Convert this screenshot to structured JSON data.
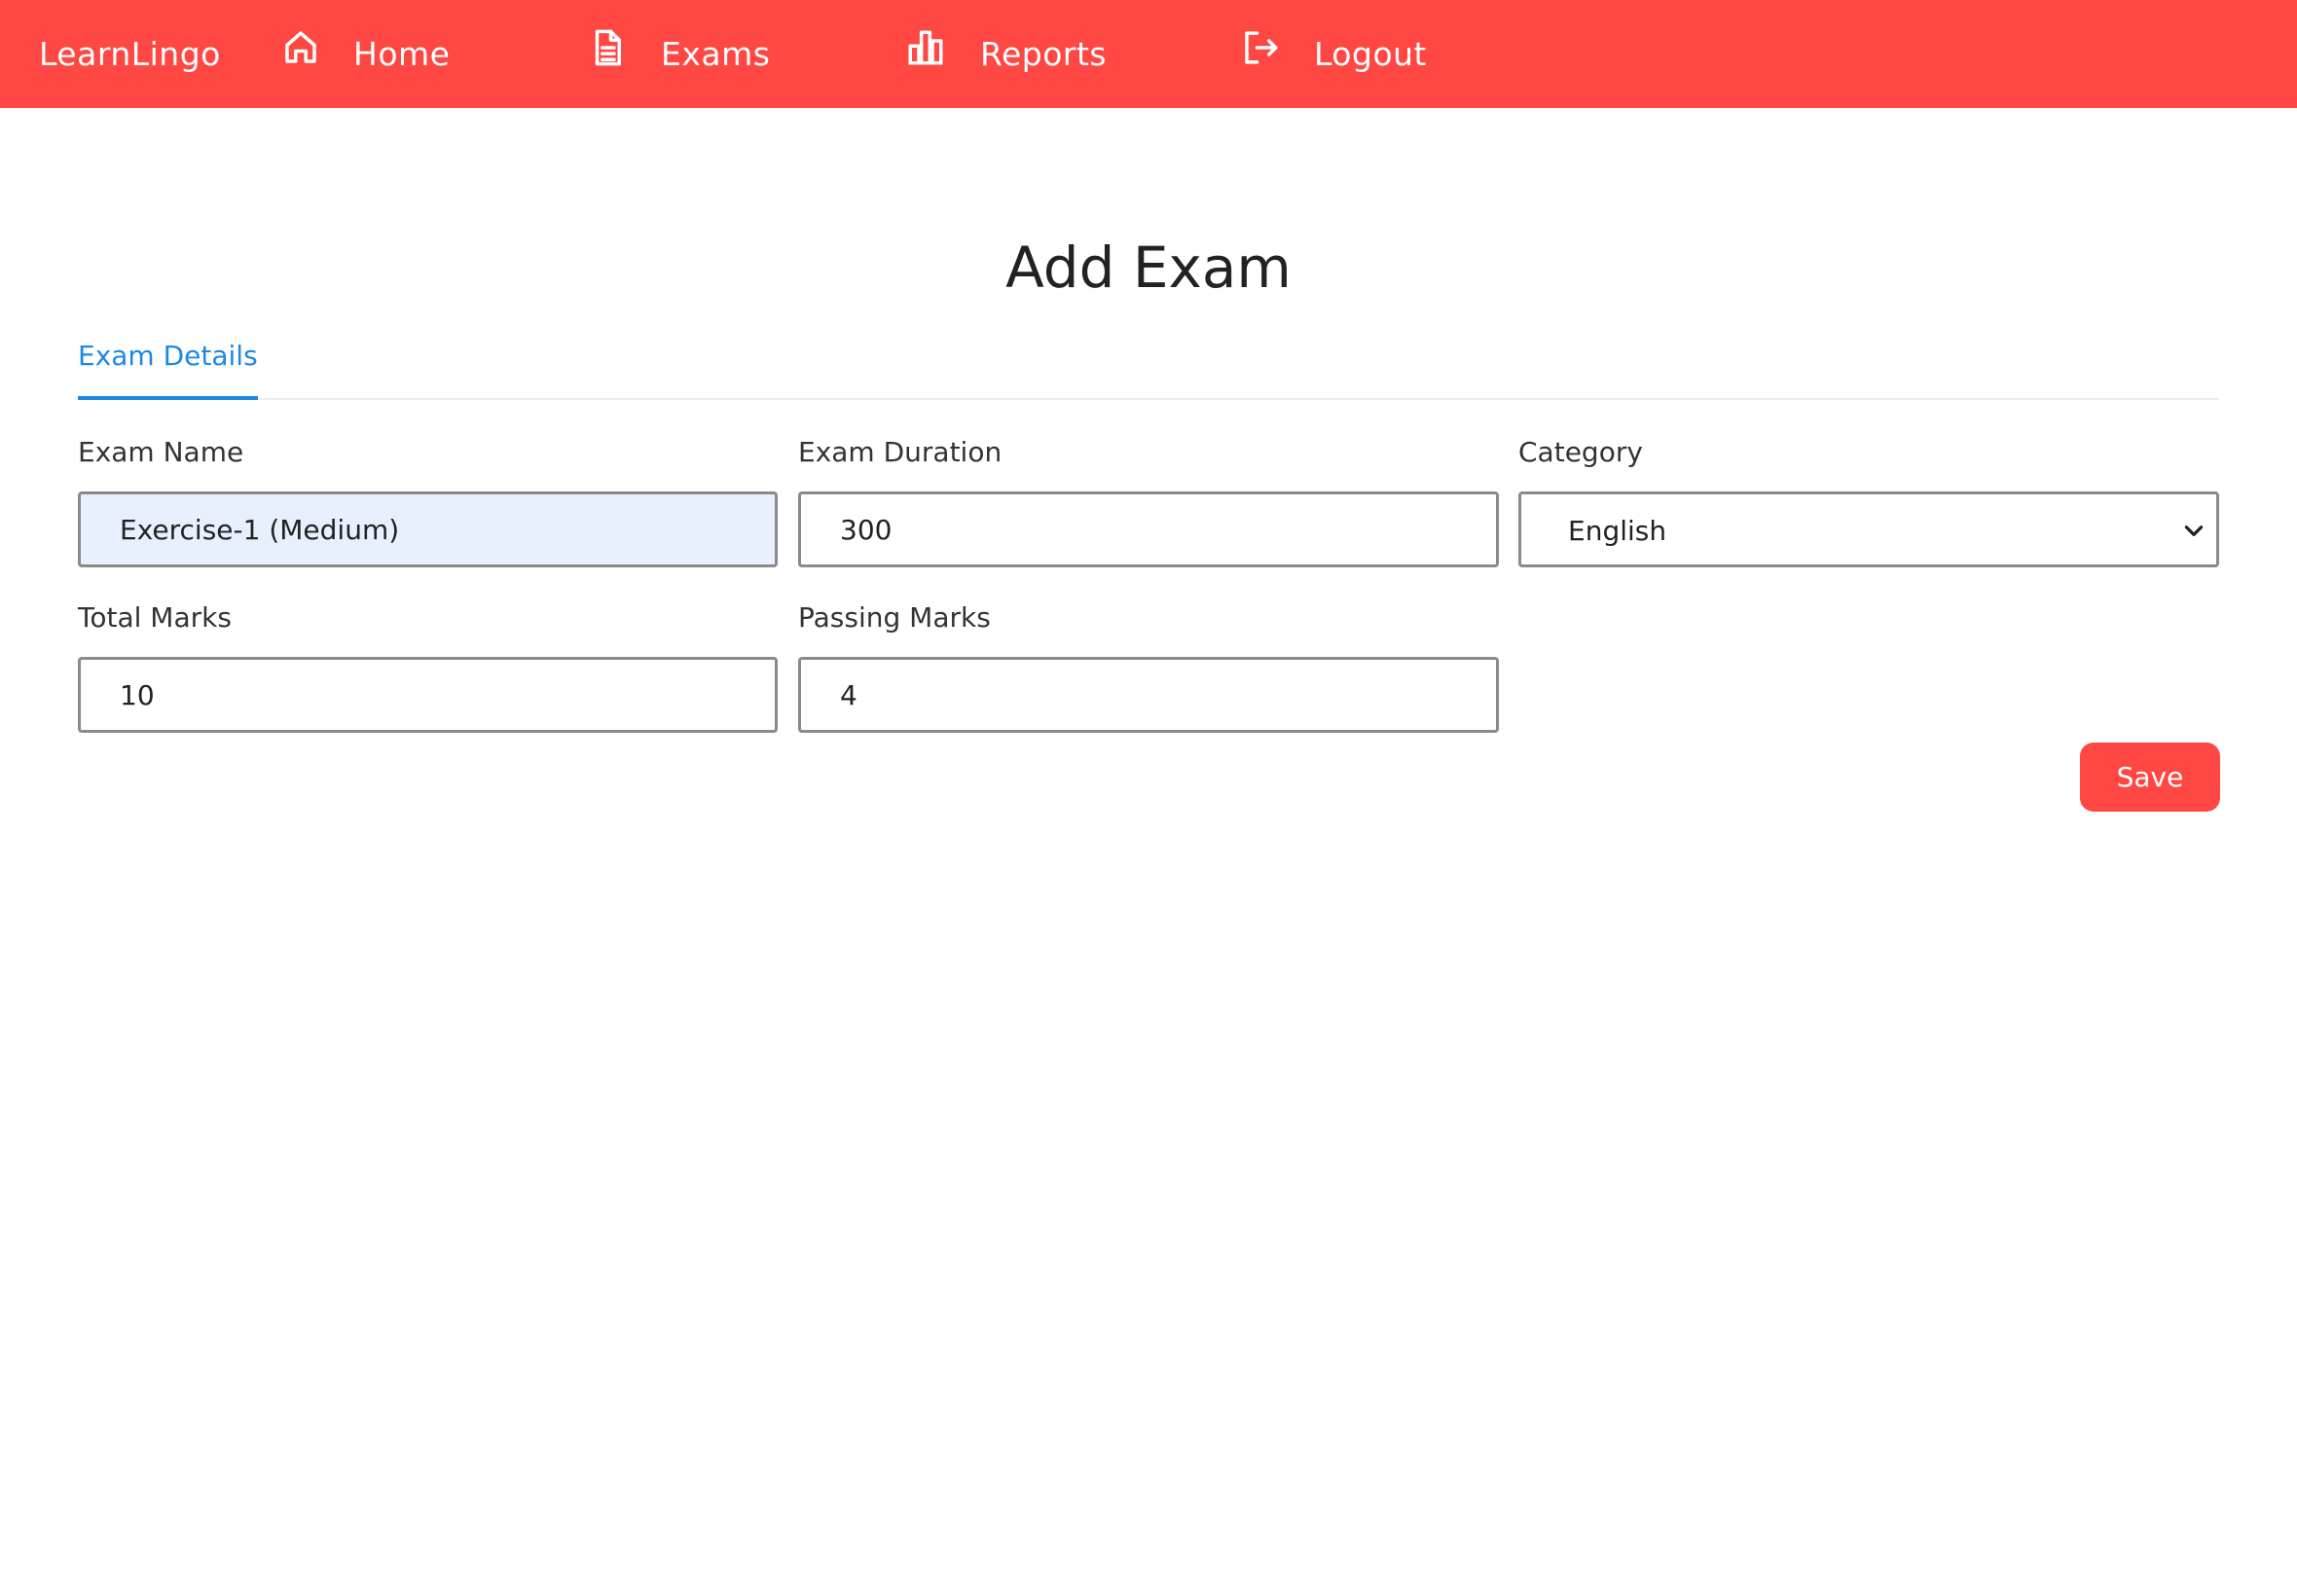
{
  "navbar": {
    "brand": "LearnLingo",
    "items": [
      {
        "label": "Home",
        "icon": "home-icon"
      },
      {
        "label": "Exams",
        "icon": "document-icon"
      },
      {
        "label": "Reports",
        "icon": "bar-chart-icon"
      },
      {
        "label": "Logout",
        "icon": "logout-icon"
      }
    ],
    "background_color": "#ff4743"
  },
  "page": {
    "title": "Add Exam"
  },
  "tabs": [
    {
      "label": "Exam Details",
      "active": true
    }
  ],
  "form": {
    "exam_name": {
      "label": "Exam Name",
      "value": "Exercise-1 (Medium)"
    },
    "exam_duration": {
      "label": "Exam Duration",
      "value": "300"
    },
    "category": {
      "label": "Category",
      "value": "English",
      "icon": "chevron-down-icon"
    },
    "total_marks": {
      "label": "Total Marks",
      "value": "10"
    },
    "passing_marks": {
      "label": "Passing Marks",
      "value": "4"
    }
  },
  "actions": {
    "save_label": "Save"
  },
  "colors": {
    "accent": "#ff4743",
    "tab_active": "#1e88e5",
    "autofill_bg": "#e8f0fe"
  }
}
